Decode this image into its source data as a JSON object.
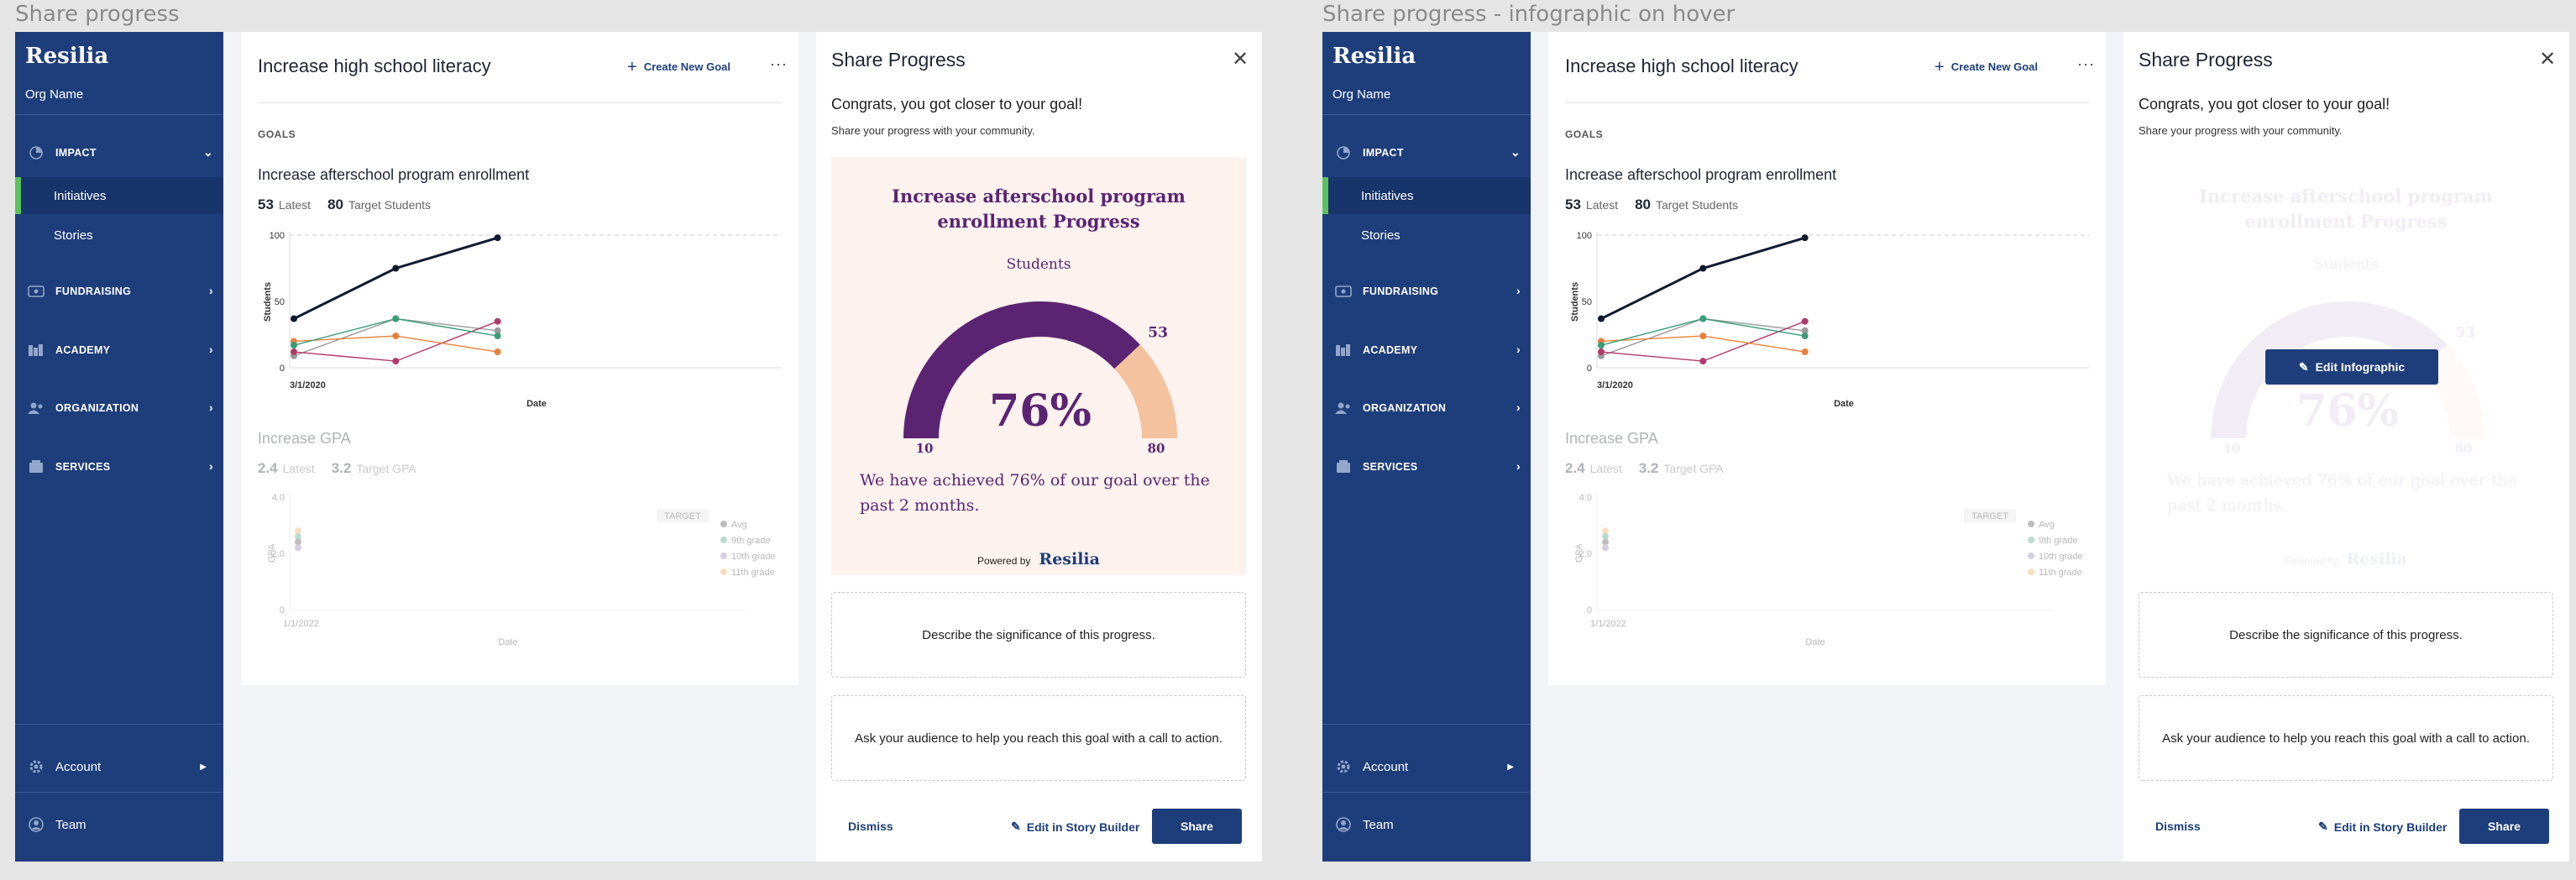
{
  "frames": [
    {
      "title": "Share progress",
      "hover": false
    },
    {
      "title": "Share progress - infographic on hover",
      "hover": true
    }
  ],
  "sidebar": {
    "brand": "Resilia",
    "org": "Org Name",
    "nav": [
      {
        "label": "IMPACT",
        "icon": "impact-icon",
        "expanded": true
      },
      {
        "label": "FUNDRAISING",
        "icon": "fundraising-icon"
      },
      {
        "label": "ACADEMY",
        "icon": "academy-icon"
      },
      {
        "label": "ORGANIZATION",
        "icon": "organization-icon"
      },
      {
        "label": "SERVICES",
        "icon": "services-icon"
      }
    ],
    "sub_items": [
      "Initiatives",
      "Stories"
    ],
    "bottom": [
      {
        "label": "Account",
        "icon": "gear-icon"
      },
      {
        "label": "Team",
        "icon": "team-icon"
      }
    ]
  },
  "goals_panel": {
    "title": "Increase high school literacy",
    "create_label": "Create New Goal",
    "more_label": "···",
    "section_label": "GOALS",
    "goal1": {
      "title": "Increase afterschool program enrollment",
      "latest_value": "53",
      "latest_label": "Latest",
      "target_value": "80",
      "target_label": "Target Students",
      "ylabel": "Students",
      "xlabel": "Date",
      "first_date": "3/1/2020"
    },
    "goal2": {
      "title": "Increase GPA",
      "latest_value": "2.4",
      "latest_label": "Latest",
      "target_value": "3.2",
      "target_label": "Target GPA",
      "ylabel": "GPA",
      "xlabel": "Date",
      "first_date": "1/1/2022",
      "target_tag": "TARGET"
    }
  },
  "share_panel": {
    "title": "Share Progress",
    "close": "✕",
    "congrats": "Congrats, you got closer to your goal!",
    "subtitle": "Share your progress with your community.",
    "infographic": {
      "title": "Increase afterschool program enrollment Progress",
      "series": "Students",
      "percent": "76%",
      "current": "53",
      "min": "10",
      "max": "80",
      "fill_fraction": 0.76,
      "text": "We have achieved 76% of our goal over the past 2 months.",
      "powered_by": "Powered by",
      "powered_brand": "Resilia",
      "colors": {
        "filled": "#5b2473",
        "remaining": "#f4c29e"
      }
    },
    "describe_placeholder": "Describe the significance of this progress.",
    "cta_placeholder": "Ask your audience to help you reach this goal with a call to action.",
    "dismiss": "Dismiss",
    "edit_story": "Edit in Story Builder",
    "share": "Share",
    "edit_infographic": "Edit Infographic"
  },
  "chart_data": [
    {
      "type": "line",
      "ylabel": "Students",
      "xlabel": "Date",
      "x": [
        "3/1/2020",
        "",
        ""
      ],
      "ylim": [
        0,
        100
      ],
      "yticks": [
        0,
        50,
        100
      ],
      "target": 100,
      "series": [
        {
          "values": [
            37,
            75,
            98
          ],
          "color": "#0f1a2e"
        },
        {
          "values": [
            17,
            37,
            24
          ],
          "color": "#3a9c76"
        },
        {
          "values": [
            20,
            24,
            12
          ],
          "color": "#e8803a"
        },
        {
          "values": [
            12,
            5,
            35
          ],
          "color": "#b03a6a"
        },
        {
          "values": [
            9,
            37,
            28
          ],
          "color": "#9a9a9a"
        }
      ]
    },
    {
      "type": "scatter",
      "ylabel": "GPA",
      "xlabel": "Date",
      "x": [
        "1/1/2022"
      ],
      "ylim": [
        0,
        4.0
      ],
      "yticks": [
        0,
        2.0,
        4.0
      ],
      "legend": [
        "Avg",
        "9th grade",
        "10th grade",
        "11th grade"
      ],
      "legend_colors": [
        "#444444",
        "#3a9c76",
        "#8c7aa8",
        "#f0a34c"
      ],
      "series": [
        {
          "name": "11th grade",
          "values": [
            2.8
          ]
        },
        {
          "name": "9th grade",
          "values": [
            2.6
          ]
        },
        {
          "name": "Avg",
          "values": [
            2.4
          ]
        },
        {
          "name": "10th grade",
          "values": [
            2.2
          ]
        }
      ]
    }
  ]
}
